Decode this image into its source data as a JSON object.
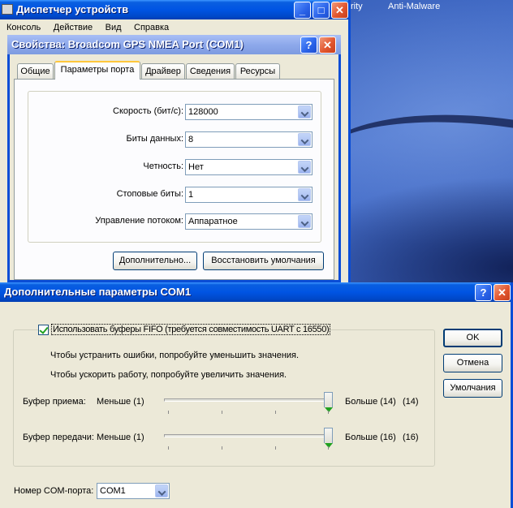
{
  "desktop": {
    "taskbar_items": [
      "rity",
      "Anti-Malware"
    ]
  },
  "device_manager": {
    "title": "Диспетчер устройств",
    "menu": [
      "Консоль",
      "Действие",
      "Вид",
      "Справка"
    ]
  },
  "properties_dialog": {
    "title": "Свойства: Broadcom GPS NMEA Port (COM1)",
    "help_glyph": "?",
    "close_glyph": "✕",
    "tabs": [
      "Общие",
      "Параметры порта",
      "Драйвер",
      "Сведения",
      "Ресурсы"
    ],
    "active_tab": "Параметры порта",
    "fields": [
      {
        "label": "Скорость (бит/с):",
        "value": "128000"
      },
      {
        "label": "Биты данных:",
        "value": "8"
      },
      {
        "label": "Четность:",
        "value": "Нет"
      },
      {
        "label": "Стоповые биты:",
        "value": "1"
      },
      {
        "label": "Управление потоком:",
        "value": "Аппаратное"
      }
    ],
    "advanced_button": "Дополнительно...",
    "restore_button": "Восстановить умолчания"
  },
  "advanced_dialog": {
    "title": "Дополнительные параметры COM1",
    "help_glyph": "?",
    "close_glyph": "✕",
    "fifo_checkbox": {
      "label": "Использовать буферы FIFO (требуется совместимость UART с 16550)",
      "checked": true
    },
    "hint_reduce": "Чтобы устранить ошибки, попробуйте уменьшить значения.",
    "hint_increase": "Чтобы ускорить работу, попробуйте увеличить значения.",
    "receive_buffer": {
      "label": "Буфер приема:",
      "min_label": "Меньше (1)",
      "max_label": "Больше (14)",
      "current": "(14)",
      "value": 14,
      "max": 14
    },
    "transmit_buffer": {
      "label": "Буфер передачи:",
      "min_label": "Меньше (1)",
      "max_label": "Больше (16)",
      "current": "(16)",
      "value": 16,
      "max": 16
    },
    "com_port_label": "Номер COM-порта:",
    "com_port_value": "COM1",
    "ok_button": "OK",
    "cancel_button": "Отмена",
    "defaults_button": "Умолчания"
  }
}
